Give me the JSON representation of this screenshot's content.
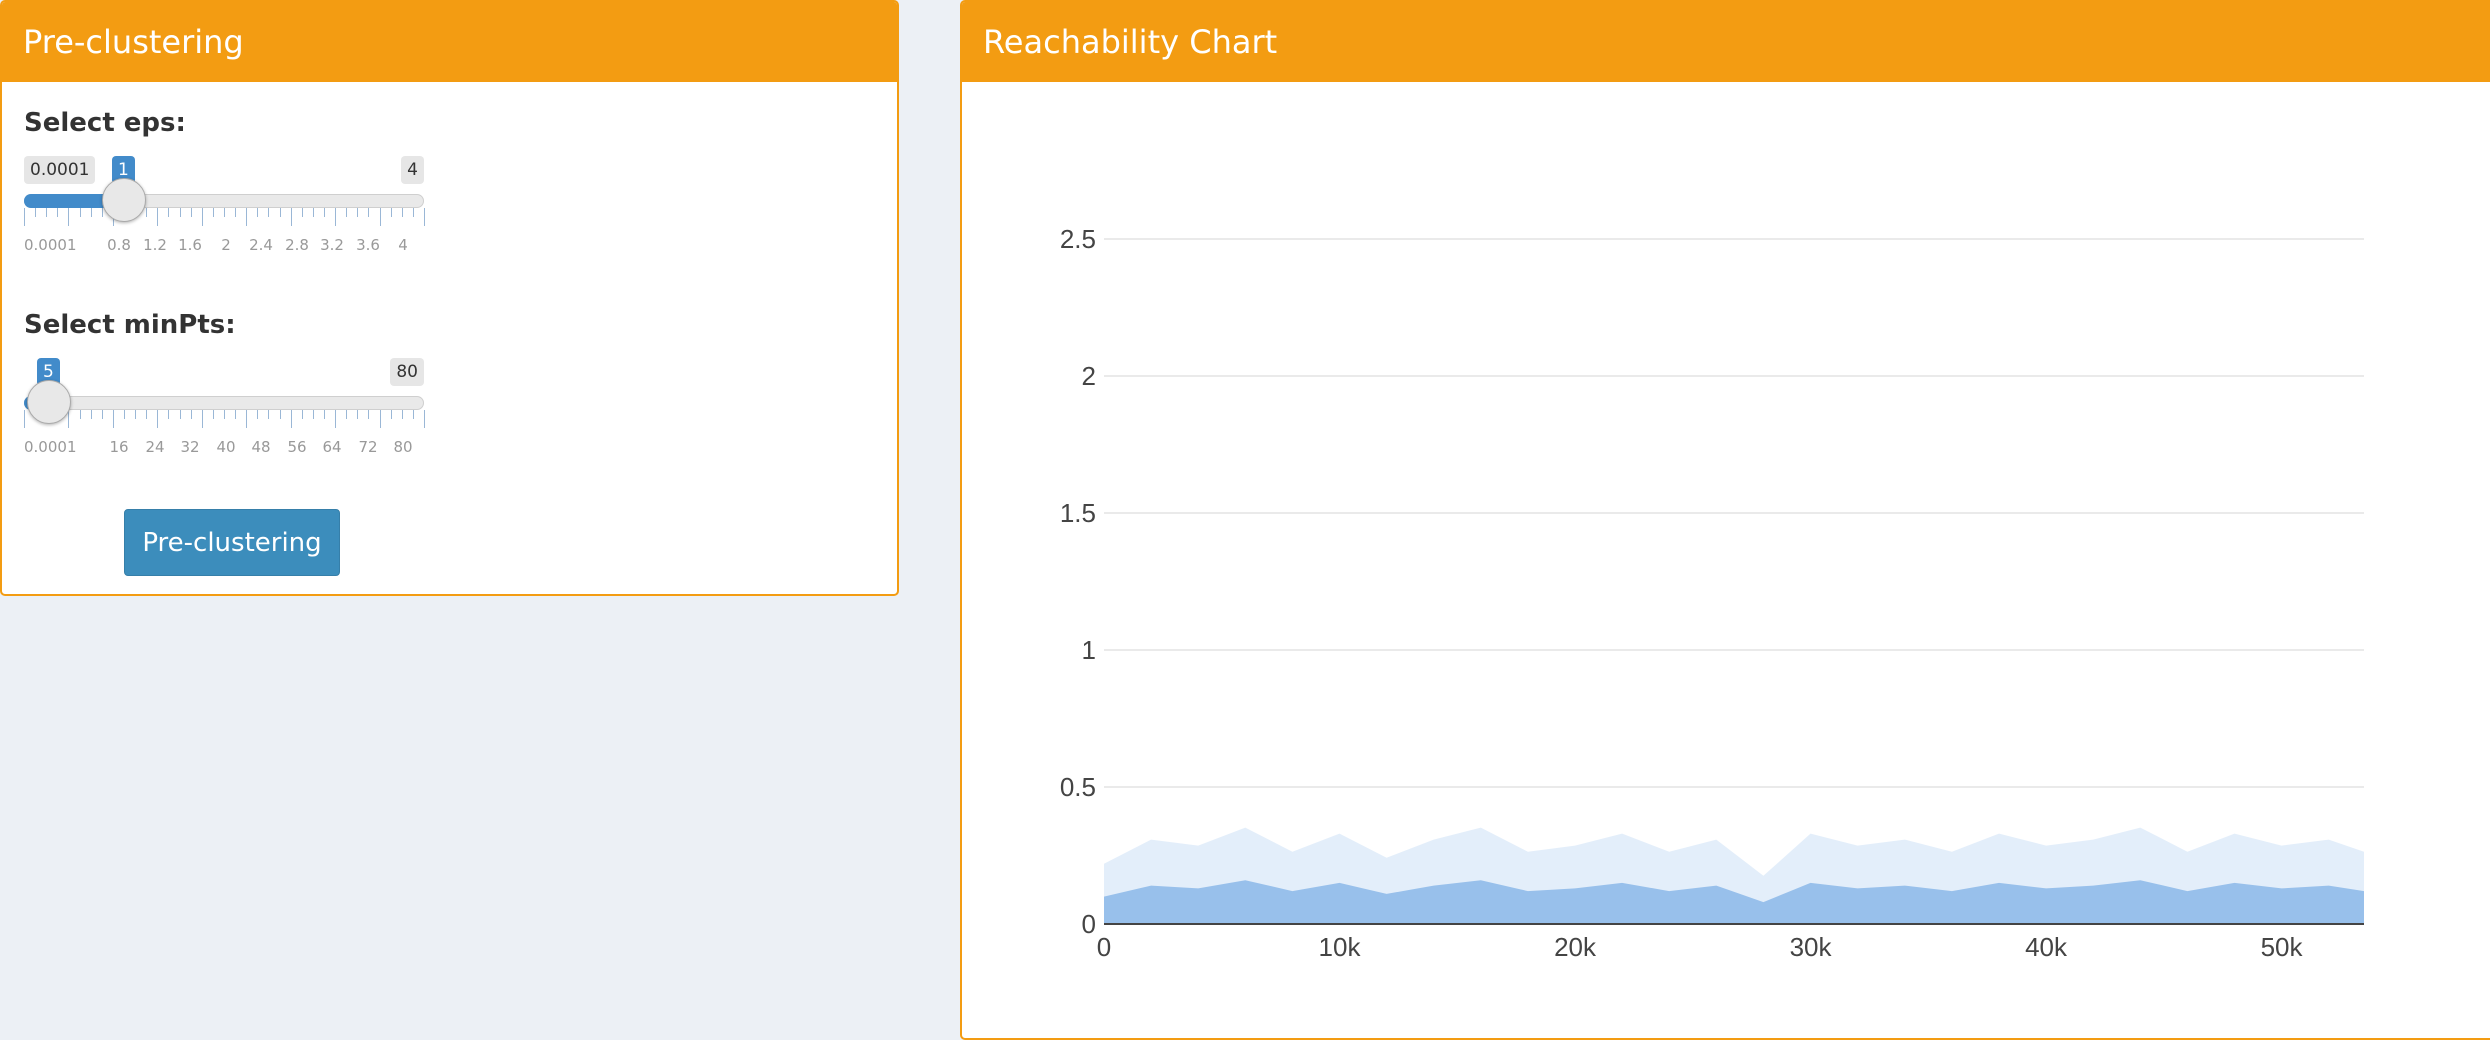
{
  "left_panel": {
    "title": "Pre-clustering",
    "eps": {
      "label": "Select eps:",
      "min_badge": "0.0001",
      "value_badge": "1",
      "max_badge": "4",
      "min": 0.0001,
      "max": 4,
      "value": 1,
      "tick_labels": [
        "0.0001",
        "0.8",
        "1.2",
        "1.6",
        "2",
        "2.4",
        "2.8",
        "3.2",
        "3.6",
        "4"
      ]
    },
    "minpts": {
      "label": "Select minPts:",
      "value_badge": "5",
      "max_badge": "80",
      "min": 0.0001,
      "max": 80,
      "value": 5,
      "tick_labels": [
        "0.0001",
        "16",
        "24",
        "32",
        "40",
        "48",
        "56",
        "64",
        "72",
        "80"
      ]
    },
    "button_label": "Pre-clustering"
  },
  "right_panel": {
    "title": "Reachability Chart"
  },
  "colors": {
    "header": "#f39c12",
    "slider_accent": "#428bca",
    "button": "#3c8dbc",
    "chart_fill": "#7fb0e6"
  },
  "chart_data": {
    "type": "area",
    "title": "",
    "xlabel": "",
    "ylabel": "",
    "x_ticks": [
      "0",
      "10k",
      "20k",
      "30k",
      "40k",
      "50k"
    ],
    "y_ticks": [
      "0",
      "0.5",
      "1",
      "1.5",
      "2",
      "2.5"
    ],
    "xlim": [
      0,
      53500
    ],
    "ylim": [
      0,
      2.5
    ],
    "grid": true,
    "series": [
      {
        "x": [
          0,
          2000,
          4000,
          6000,
          8000,
          10000,
          12000,
          14000,
          16000,
          18000,
          20000,
          22000,
          24000,
          26000,
          28000,
          30000,
          32000,
          34000,
          36000,
          38000,
          40000,
          42000,
          44000,
          46000,
          48000,
          50000,
          52000,
          53500
        ],
        "y": [
          0.1,
          0.14,
          0.13,
          0.16,
          0.12,
          0.15,
          0.11,
          0.14,
          0.16,
          0.12,
          0.13,
          0.15,
          0.12,
          0.14,
          0.08,
          0.15,
          0.13,
          0.14,
          0.12,
          0.15,
          0.13,
          0.14,
          0.16,
          0.12,
          0.15,
          0.13,
          0.14,
          0.12
        ]
      }
    ]
  }
}
